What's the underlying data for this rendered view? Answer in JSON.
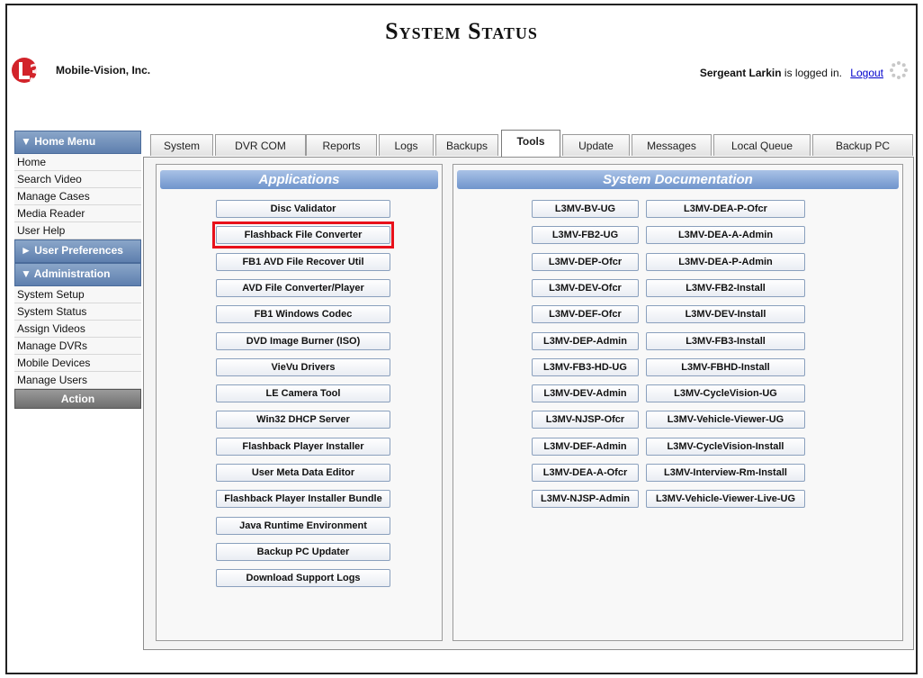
{
  "header": {
    "title": "System Status",
    "company": "Mobile-Vision, Inc.",
    "logo_text": "L3",
    "user": "Sergeant Larkin",
    "logged_in_text": "is logged in.",
    "logout_label": "Logout"
  },
  "sidebar": {
    "home_menu": {
      "label": "▼ Home Menu",
      "items": [
        "Home",
        "Search Video",
        "Manage Cases",
        "Media Reader",
        "User Help"
      ]
    },
    "user_preferences": {
      "label": "► User Preferences"
    },
    "administration": {
      "label": "▼ Administration",
      "items": [
        "System Setup",
        "System Status",
        "Assign Videos",
        "Manage DVRs",
        "Mobile Devices",
        "Manage Users"
      ]
    },
    "action_label": "Action"
  },
  "tabs": [
    "System",
    "DVR COM",
    "Reports",
    "Logs",
    "Backups",
    "Tools",
    "Update",
    "Messages",
    "Local Queue",
    "Backup PC"
  ],
  "active_tab": "Tools",
  "applications": {
    "title": "Applications",
    "buttons": [
      "Disc Validator",
      "Flashback File Converter",
      "FB1 AVD File Recover Util",
      "AVD File Converter/Player",
      "FB1 Windows Codec",
      "DVD Image Burner (ISO)",
      "VieVu Drivers",
      "LE Camera Tool",
      "Win32 DHCP Server",
      "Flashback Player Installer",
      "User Meta Data Editor",
      "Flashback Player Installer Bundle",
      "Java Runtime Environment",
      "Backup PC Updater",
      "Download Support Logs"
    ],
    "highlighted": "Flashback File Converter"
  },
  "documentation": {
    "title": "System Documentation",
    "left": [
      "L3MV-BV-UG",
      "L3MV-FB2-UG",
      "L3MV-DEP-Ofcr",
      "L3MV-DEV-Ofcr",
      "L3MV-DEF-Ofcr",
      "L3MV-DEP-Admin",
      "L3MV-FB3-HD-UG",
      "L3MV-DEV-Admin",
      "L3MV-NJSP-Ofcr",
      "L3MV-DEF-Admin",
      "L3MV-DEA-A-Ofcr",
      "L3MV-NJSP-Admin"
    ],
    "right": [
      "L3MV-DEA-P-Ofcr",
      "L3MV-DEA-A-Admin",
      "L3MV-DEA-P-Admin",
      "L3MV-FB2-Install",
      "L3MV-DEV-Install",
      "L3MV-FB3-Install",
      "L3MV-FBHD-Install",
      "L3MV-CycleVision-UG",
      "L3MV-Vehicle-Viewer-UG",
      "L3MV-CycleVision-Install",
      "L3MV-Interview-Rm-Install",
      "L3MV-Vehicle-Viewer-Live-UG"
    ]
  },
  "colors": {
    "accent": "#6f94cc",
    "highlight": "#e8101a",
    "logo_red": "#d2232a"
  }
}
